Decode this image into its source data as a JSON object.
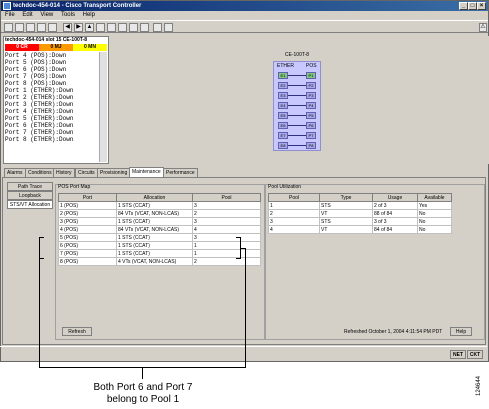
{
  "window": {
    "title": "techdoc-454-014 - Cisco Transport Controller"
  },
  "menu": [
    "File",
    "Edit",
    "View",
    "Tools",
    "Help"
  ],
  "node": {
    "header": "techdoc-454-014 slot 15 CE-100T-8",
    "alarms": [
      {
        "label": "0 CR",
        "color": "#ff0000"
      },
      {
        "label": "0 MJ",
        "color": "#ff9900"
      },
      {
        "label": "0 MN",
        "color": "#ffff00"
      }
    ],
    "ports": [
      "Port 4 (POS):Down",
      "Port 5 (POS):Down",
      "Port 6 (POS):Down",
      "Port 7 (POS):Down",
      "Port 8 (POS):Down",
      "Port 1 (ETHER):Down",
      "Port 2 (ETHER):Down",
      "Port 3 (ETHER):Down",
      "Port 4 (ETHER):Down",
      "Port 5 (ETHER):Down",
      "Port 6 (ETHER):Down",
      "Port 7 (ETHER):Down",
      "Port 8 (ETHER):Down"
    ]
  },
  "card": {
    "title": "CE-100T-8",
    "ether_label": "ETHER",
    "pos_label": "POS",
    "ether_ports": [
      "E1",
      "E2",
      "E3",
      "E4",
      "E5",
      "E6",
      "E7",
      "E8"
    ],
    "pos_ports": [
      "P1",
      "P2",
      "P3",
      "P4",
      "P5",
      "P6",
      "P7",
      "P8"
    ]
  },
  "tabs": [
    "Alarms",
    "Conditions",
    "History",
    "Circuits",
    "Provisioning",
    "Maintenance",
    "Performance"
  ],
  "active_tab": "Maintenance",
  "subtabs": [
    "Path Trace",
    "Loopback",
    "STS/VT Allocation"
  ],
  "pos_port_map": {
    "title": "POS Port Map",
    "headers": [
      "Port",
      "Allocation",
      "Pool"
    ],
    "rows": [
      [
        "1 (POS)",
        "1 STS (CCAT)",
        "3"
      ],
      [
        "2 (POS)",
        "84 VTs (VCAT, NON-LCAS)",
        "2"
      ],
      [
        "3 (POS)",
        "1 STS (CCAT)",
        "3"
      ],
      [
        "4 (POS)",
        "84 VTs (VCAT, NON-LCAS)",
        "4"
      ],
      [
        "5 (POS)",
        "1 STS (CCAT)",
        "3"
      ],
      [
        "6 (POS)",
        "1 STS (CCAT)",
        "1"
      ],
      [
        "7 (POS)",
        "1 STS (CCAT)",
        "1"
      ],
      [
        "8 (POS)",
        "4 VTs (VCAT, NON-LCAS)",
        "2"
      ]
    ]
  },
  "pool_util": {
    "title": "Pool Utilization",
    "headers": [
      "Pool",
      "Type",
      "Usage",
      "Available"
    ],
    "rows": [
      [
        "1",
        "STS",
        "2 of 3",
        "Yes"
      ],
      [
        "2",
        "VT",
        "88 of 84",
        "No"
      ],
      [
        "3",
        "STS",
        "3 of 3",
        "No"
      ],
      [
        "4",
        "VT",
        "84 of 84",
        "No"
      ]
    ]
  },
  "buttons": {
    "refresh": "Refresh",
    "help": "Help"
  },
  "refreshed_text": "Refreshed October 1, 2004 4:11:54 PM PDT",
  "status": {
    "net": "NET",
    "ckt": "CKT"
  },
  "caption": {
    "line1": "Both Port 6 and Port 7",
    "line2": "belong to Pool 1"
  },
  "figure_id": "124644"
}
